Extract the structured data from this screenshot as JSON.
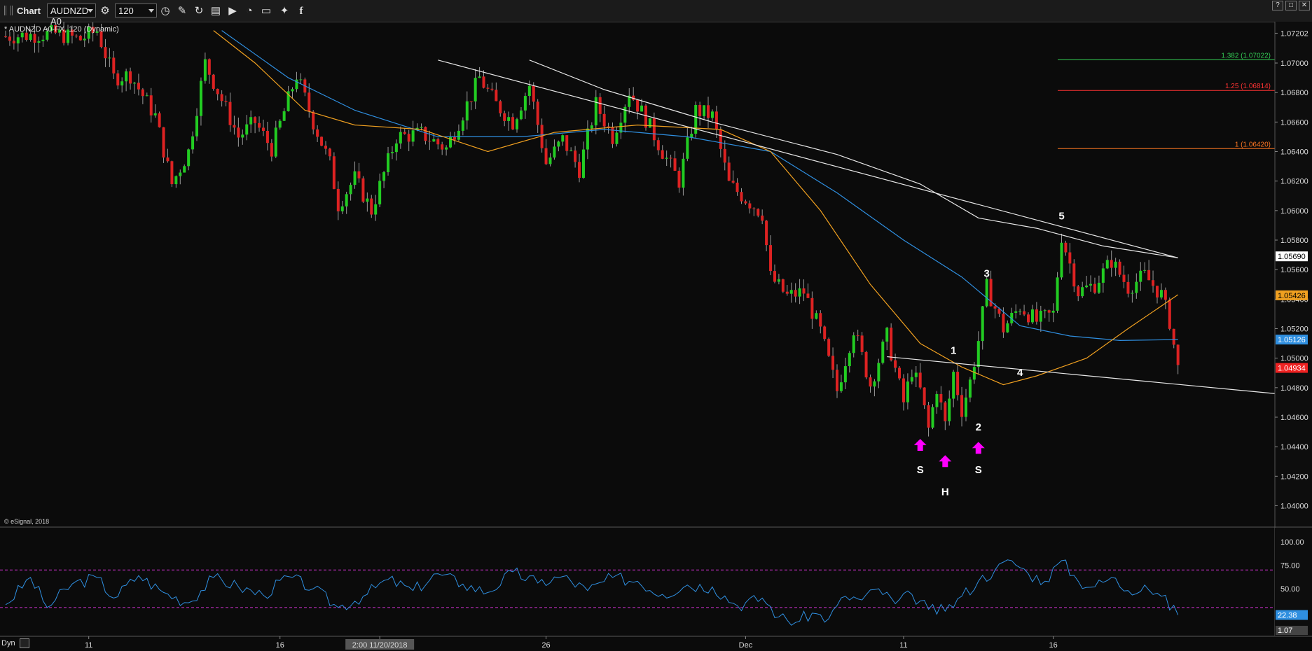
{
  "toolbar": {
    "title": "Chart",
    "symbol": "AUDNZD A0",
    "interval": "120",
    "icons": [
      "settings-gear-icon",
      "clock-icon",
      "pencil-icon",
      "refresh-icon",
      "tools-icon",
      "play-icon",
      "clock-search-icon",
      "comment-icon",
      "twitter-icon",
      "facebook-icon"
    ],
    "window_buttons": [
      "?",
      "□",
      "✕"
    ]
  },
  "symbol_label": "* AUDNZD A0-FX, 120 (Dynamic)",
  "copyright": "© eSignal, 2018",
  "dyn_label": "Dyn",
  "colors": {
    "background": "#0b0b0b",
    "up_candle": "#22cc22",
    "down_candle": "#dd2222",
    "ma_white": "#e8e8e8",
    "ma_blue": "#2f8fe0",
    "ma_orange": "#f0a020",
    "rsi": "#2f8fe0",
    "rsi_bands": "#d030d0",
    "annotation_arrow": "#ff00ff"
  },
  "chart_data": [
    {
      "type": "candlestick",
      "title": "",
      "ylim": [
        1.0386,
        1.0728
      ],
      "y_ticks": [
        "1.07202",
        "1.07000",
        "1.06800",
        "1.06600",
        "1.06400",
        "1.06200",
        "1.06000",
        "1.05800",
        "1.05600",
        "1.05400",
        "1.05200",
        "1.05000",
        "1.04800",
        "1.04600",
        "1.04400",
        "1.04200",
        "1.04000"
      ],
      "x_tick_labels": [
        "11",
        "16",
        "2:00 11/20/2018",
        "26",
        "Dec",
        "11",
        "16"
      ],
      "x_tick_index": [
        10,
        33,
        45,
        65,
        89,
        108,
        126
      ],
      "bars_count": 152,
      "close_path": [
        {
          "i": 0,
          "p": 1.0718
        },
        {
          "i": 6,
          "p": 1.072
        },
        {
          "i": 9,
          "p": 1.0716
        },
        {
          "i": 11,
          "p": 1.0722
        },
        {
          "i": 13,
          "p": 1.069
        },
        {
          "i": 15,
          "p": 1.0692
        },
        {
          "i": 18,
          "p": 1.0664
        },
        {
          "i": 20,
          "p": 1.0618
        },
        {
          "i": 22,
          "p": 1.064
        },
        {
          "i": 24,
          "p": 1.07
        },
        {
          "i": 26,
          "p": 1.0675
        },
        {
          "i": 28,
          "p": 1.065
        },
        {
          "i": 30,
          "p": 1.066
        },
        {
          "i": 32,
          "p": 1.0642
        },
        {
          "i": 35,
          "p": 1.0692
        },
        {
          "i": 37,
          "p": 1.066
        },
        {
          "i": 39,
          "p": 1.0632
        },
        {
          "i": 40,
          "p": 1.0604
        },
        {
          "i": 42,
          "p": 1.0622
        },
        {
          "i": 44,
          "p": 1.06
        },
        {
          "i": 47,
          "p": 1.065
        },
        {
          "i": 50,
          "p": 1.0652
        },
        {
          "i": 53,
          "p": 1.0642
        },
        {
          "i": 57,
          "p": 1.069
        },
        {
          "i": 59,
          "p": 1.0672
        },
        {
          "i": 61,
          "p": 1.066
        },
        {
          "i": 63,
          "p": 1.0685
        },
        {
          "i": 65,
          "p": 1.0632
        },
        {
          "i": 67,
          "p": 1.0648
        },
        {
          "i": 69,
          "p": 1.0628
        },
        {
          "i": 71,
          "p": 1.0672
        },
        {
          "i": 73,
          "p": 1.065
        },
        {
          "i": 75,
          "p": 1.0681
        },
        {
          "i": 77,
          "p": 1.0662
        },
        {
          "i": 79,
          "p": 1.064
        },
        {
          "i": 81,
          "p": 1.062
        },
        {
          "i": 83,
          "p": 1.0668
        },
        {
          "i": 85,
          "p": 1.0664
        },
        {
          "i": 87,
          "p": 1.0618
        },
        {
          "i": 89,
          "p": 1.0608
        },
        {
          "i": 91,
          "p": 1.0598
        },
        {
          "i": 92,
          "p": 1.0555
        },
        {
          "i": 94,
          "p": 1.0542
        },
        {
          "i": 96,
          "p": 1.0545
        },
        {
          "i": 98,
          "p": 1.0518
        },
        {
          "i": 100,
          "p": 1.0478
        },
        {
          "i": 102,
          "p": 1.052
        },
        {
          "i": 104,
          "p": 1.0482
        },
        {
          "i": 106,
          "p": 1.0515
        },
        {
          "i": 108,
          "p": 1.047
        },
        {
          "i": 109,
          "p": 1.0492
        },
        {
          "i": 110,
          "p": 1.0478
        },
        {
          "i": 111,
          "p": 1.0452
        },
        {
          "i": 112,
          "p": 1.048
        },
        {
          "i": 113,
          "p": 1.0455
        },
        {
          "i": 114,
          "p": 1.049
        },
        {
          "i": 115,
          "p": 1.0465
        },
        {
          "i": 116,
          "p": 1.0484
        },
        {
          "i": 117,
          "p": 1.0512
        },
        {
          "i": 118,
          "p": 1.0548
        },
        {
          "i": 120,
          "p": 1.052
        },
        {
          "i": 122,
          "p": 1.0535
        },
        {
          "i": 124,
          "p": 1.0525
        },
        {
          "i": 126,
          "p": 1.053
        },
        {
          "i": 127,
          "p": 1.0583
        },
        {
          "i": 129,
          "p": 1.0545
        },
        {
          "i": 131,
          "p": 1.055
        },
        {
          "i": 133,
          "p": 1.0566
        },
        {
          "i": 135,
          "p": 1.0548
        },
        {
          "i": 137,
          "p": 1.0556
        },
        {
          "i": 139,
          "p": 1.0543
        },
        {
          "i": 140,
          "p": 1.0525
        },
        {
          "i": 141,
          "p": 1.0493
        }
      ],
      "moving_averages": [
        {
          "name": "",
          "color": "#e8e8e8",
          "points": [
            {
              "i": 63,
              "p": 1.0702
            },
            {
              "i": 72,
              "p": 1.0682
            },
            {
              "i": 85,
              "p": 1.066
            },
            {
              "i": 100,
              "p": 1.0638
            },
            {
              "i": 110,
              "p": 1.0618
            },
            {
              "i": 117,
              "p": 1.0595
            },
            {
              "i": 124,
              "p": 1.0588
            },
            {
              "i": 132,
              "p": 1.0576
            },
            {
              "i": 141,
              "p": 1.0568
            }
          ]
        },
        {
          "name": "",
          "color": "#2f8fe0",
          "points": [
            {
              "i": 26,
              "p": 1.0722
            },
            {
              "i": 34,
              "p": 1.069
            },
            {
              "i": 42,
              "p": 1.0668
            },
            {
              "i": 52,
              "p": 1.065
            },
            {
              "i": 62,
              "p": 1.065
            },
            {
              "i": 72,
              "p": 1.0655
            },
            {
              "i": 82,
              "p": 1.065
            },
            {
              "i": 92,
              "p": 1.064
            },
            {
              "i": 100,
              "p": 1.0612
            },
            {
              "i": 108,
              "p": 1.058
            },
            {
              "i": 115,
              "p": 1.0555
            },
            {
              "i": 122,
              "p": 1.0522
            },
            {
              "i": 128,
              "p": 1.0515
            },
            {
              "i": 134,
              "p": 1.0512
            },
            {
              "i": 141,
              "p": 1.05126
            }
          ]
        },
        {
          "name": "",
          "color": "#f0a020",
          "points": [
            {
              "i": 25,
              "p": 1.0722
            },
            {
              "i": 30,
              "p": 1.07
            },
            {
              "i": 36,
              "p": 1.0668
            },
            {
              "i": 42,
              "p": 1.0658
            },
            {
              "i": 50,
              "p": 1.0655
            },
            {
              "i": 58,
              "p": 1.064
            },
            {
              "i": 66,
              "p": 1.0653
            },
            {
              "i": 76,
              "p": 1.0658
            },
            {
              "i": 86,
              "p": 1.0655
            },
            {
              "i": 92,
              "p": 1.064
            },
            {
              "i": 98,
              "p": 1.06
            },
            {
              "i": 104,
              "p": 1.055
            },
            {
              "i": 110,
              "p": 1.051
            },
            {
              "i": 115,
              "p": 1.0494
            },
            {
              "i": 120,
              "p": 1.0482
            },
            {
              "i": 124,
              "p": 1.0488
            },
            {
              "i": 130,
              "p": 1.05
            },
            {
              "i": 135,
              "p": 1.052
            },
            {
              "i": 141,
              "p": 1.0543
            }
          ]
        }
      ],
      "trendlines": [
        {
          "color": "#e8e8e8",
          "from": {
            "i": 52,
            "p": 1.0702
          },
          "to": {
            "i": 141,
            "p": 1.0568
          }
        },
        {
          "color": "#e8e8e8",
          "from": {
            "i": 106,
            "p": 1.0501
          },
          "to": {
            "i": 158,
            "p": 1.0476
          }
        }
      ],
      "fib_levels": [
        {
          "label": "1.382 (1.07022)",
          "price": 1.07022,
          "color": "#33cc55"
        },
        {
          "label": "1.25 (1.06814)",
          "price": 1.06814,
          "color": "#ff3333"
        },
        {
          "label": "1 (1.06420)",
          "price": 1.0642,
          "color": "#ff7722"
        }
      ],
      "price_tags": [
        {
          "label": "1.05690",
          "price": 1.0569,
          "bg": "#ffffff",
          "fg": "#000000"
        },
        {
          "label": "1.05426",
          "price": 1.05426,
          "bg": "#f0a020",
          "fg": "#000000"
        },
        {
          "label": "1.05126",
          "price": 1.05126,
          "bg": "#2f8fe0",
          "fg": "#ffffff"
        },
        {
          "label": "1.04934",
          "price": 1.04934,
          "bg": "#ee2222",
          "fg": "#ffffff"
        }
      ],
      "wave_labels": [
        {
          "text": "1",
          "i": 114,
          "p": 1.0503
        },
        {
          "text": "2",
          "i": 117,
          "p": 1.0451
        },
        {
          "text": "3",
          "i": 118,
          "p": 1.0555
        },
        {
          "text": "4",
          "i": 122,
          "p": 1.0488
        },
        {
          "text": "5",
          "i": 127,
          "p": 1.0594
        }
      ],
      "pattern_labels": [
        {
          "text": "S",
          "i": 110,
          "p": 1.0422
        },
        {
          "text": "H",
          "i": 113,
          "p": 1.0407
        },
        {
          "text": "S",
          "i": 117,
          "p": 1.0422
        }
      ],
      "arrows": [
        {
          "i": 110,
          "p": 1.0441
        },
        {
          "i": 113,
          "p": 1.043
        },
        {
          "i": 117,
          "p": 1.0439
        }
      ]
    },
    {
      "type": "line",
      "name": "RSI",
      "ylim": [
        0,
        115
      ],
      "y_ticks": [
        "100.00",
        "75.00",
        "50.00"
      ],
      "bands": [
        70,
        30
      ],
      "current_label": "22.38",
      "bottom_label": "1.07",
      "points": [
        {
          "i": 0,
          "v": 33
        },
        {
          "i": 3,
          "v": 62
        },
        {
          "i": 5,
          "v": 30
        },
        {
          "i": 8,
          "v": 55
        },
        {
          "i": 11,
          "v": 62
        },
        {
          "i": 13,
          "v": 40
        },
        {
          "i": 16,
          "v": 64
        },
        {
          "i": 19,
          "v": 46
        },
        {
          "i": 22,
          "v": 35
        },
        {
          "i": 25,
          "v": 62
        },
        {
          "i": 28,
          "v": 52
        },
        {
          "i": 31,
          "v": 43
        },
        {
          "i": 34,
          "v": 63
        },
        {
          "i": 37,
          "v": 50
        },
        {
          "i": 40,
          "v": 30
        },
        {
          "i": 43,
          "v": 42
        },
        {
          "i": 46,
          "v": 60
        },
        {
          "i": 49,
          "v": 48
        },
        {
          "i": 52,
          "v": 66
        },
        {
          "i": 55,
          "v": 55
        },
        {
          "i": 58,
          "v": 46
        },
        {
          "i": 61,
          "v": 68
        },
        {
          "i": 64,
          "v": 56
        },
        {
          "i": 67,
          "v": 63
        },
        {
          "i": 70,
          "v": 48
        },
        {
          "i": 73,
          "v": 62
        },
        {
          "i": 76,
          "v": 58
        },
        {
          "i": 79,
          "v": 44
        },
        {
          "i": 82,
          "v": 54
        },
        {
          "i": 85,
          "v": 52
        },
        {
          "i": 88,
          "v": 32
        },
        {
          "i": 91,
          "v": 40
        },
        {
          "i": 93,
          "v": 20
        },
        {
          "i": 95,
          "v": 14
        },
        {
          "i": 97,
          "v": 24
        },
        {
          "i": 99,
          "v": 18
        },
        {
          "i": 101,
          "v": 42
        },
        {
          "i": 103,
          "v": 38
        },
        {
          "i": 105,
          "v": 50
        },
        {
          "i": 107,
          "v": 34
        },
        {
          "i": 109,
          "v": 44
        },
        {
          "i": 111,
          "v": 28
        },
        {
          "i": 113,
          "v": 26
        },
        {
          "i": 115,
          "v": 42
        },
        {
          "i": 117,
          "v": 58
        },
        {
          "i": 119,
          "v": 70
        },
        {
          "i": 121,
          "v": 80
        },
        {
          "i": 123,
          "v": 66
        },
        {
          "i": 125,
          "v": 58
        },
        {
          "i": 127,
          "v": 80
        },
        {
          "i": 129,
          "v": 58
        },
        {
          "i": 131,
          "v": 52
        },
        {
          "i": 133,
          "v": 62
        },
        {
          "i": 135,
          "v": 48
        },
        {
          "i": 137,
          "v": 54
        },
        {
          "i": 139,
          "v": 42
        },
        {
          "i": 141,
          "v": 22
        }
      ]
    }
  ]
}
